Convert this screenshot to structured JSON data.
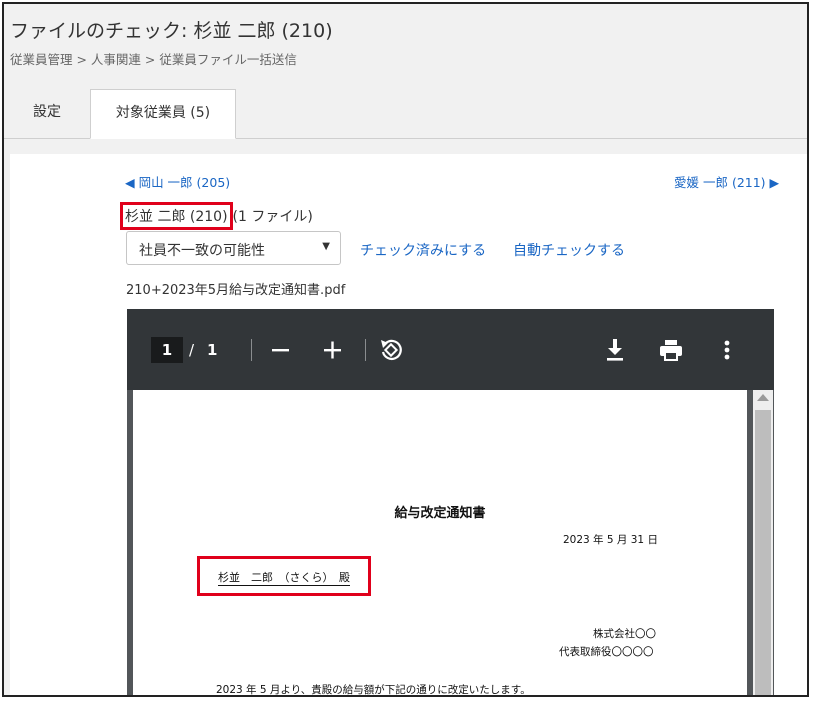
{
  "header": {
    "title": "ファイルのチェック: 杉並 二郎 (210)",
    "breadcrumb": "従業員管理 > 人事関連 > 従業員ファイル一括送信"
  },
  "tabs": [
    {
      "label": "設定"
    },
    {
      "label": "対象従業員 (5)"
    }
  ],
  "nav": {
    "prev_label": "◀ 岡山 一郎 (205)",
    "next_label": "愛媛 一郎 (211) ▶"
  },
  "employee": {
    "name": "杉並 二郎 (210)",
    "file_count": "(1 ファイル)"
  },
  "filter_select": {
    "value": "社員不一致の可能性"
  },
  "actions": {
    "mark_checked": "チェック済みにする",
    "auto_check": "自動チェックする"
  },
  "file": {
    "name": "210+2023年5月給与改定通知書.pdf"
  },
  "pdf_viewer": {
    "current_page": "1",
    "separator": "/",
    "total_pages": "1",
    "icons": [
      "zoom-out-icon",
      "zoom-in-icon",
      "rotate-icon",
      "download-icon",
      "print-icon",
      "more-vert-icon"
    ]
  },
  "document": {
    "title": "給与改定通知書",
    "date": "2023 年 5 月 31 日",
    "recipient": "杉並　二郎　（さくら）　殿",
    "company": "株式会社〇〇",
    "representative": "代表取締役〇〇〇〇",
    "body_line": "2023 年 5 月より、貴殿の給与額が下記の通りに改定いたします。"
  },
  "colors": {
    "link": "#1a66c4",
    "highlight_box": "#e0001b",
    "pdf_toolbar": "#323639"
  }
}
